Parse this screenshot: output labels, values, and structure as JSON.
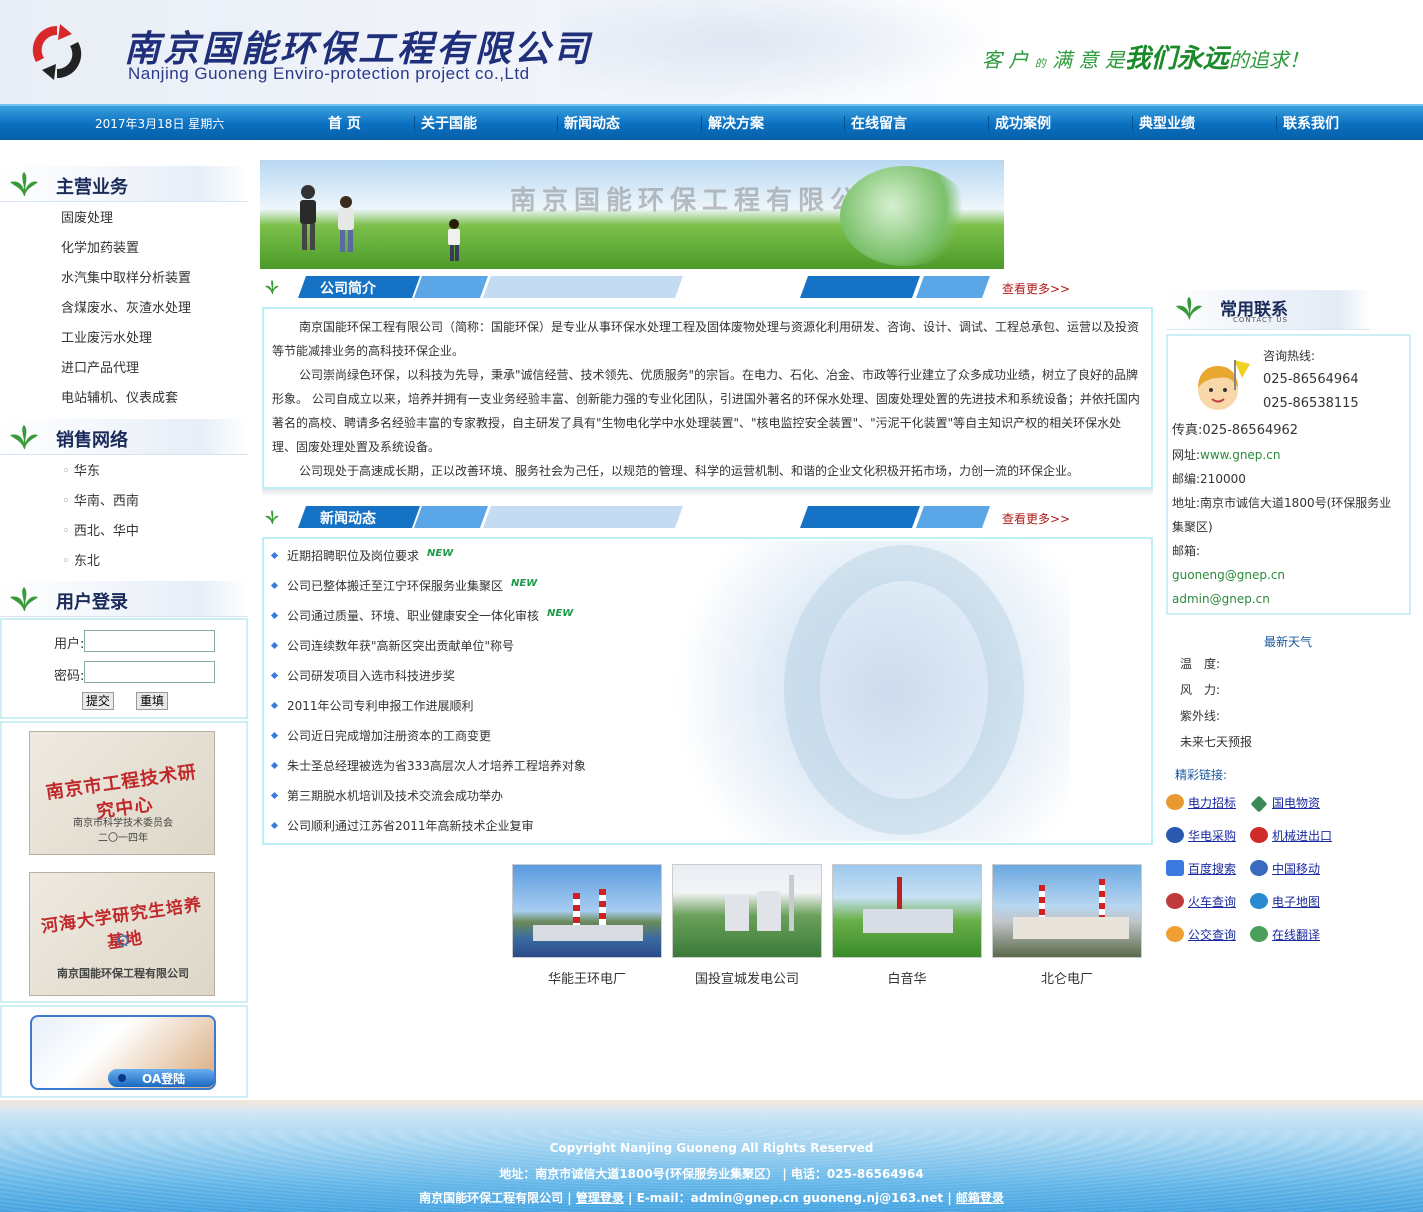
{
  "header": {
    "company_cn": "南京国能环保工程有限公司",
    "company_en": "Nanjing Guoneng Enviro-protection project co.,Ltd",
    "slogan_1": "客 户",
    "slogan_2": "的",
    "slogan_3": "满 意 是",
    "slogan_4": "我们永远",
    "slogan_5": "的追求！"
  },
  "nav": {
    "date": "2017年3月18日  星期六",
    "items": [
      "首 页",
      "关于国能",
      "新闻动态",
      "解决方案",
      "在线留言",
      "成功案例",
      "典型业绩",
      "联系我们"
    ]
  },
  "left": {
    "business_title": "主营业务",
    "business_items": [
      "固废处理",
      "化学加药装置",
      "水汽集中取样分析装置",
      "含煤废水、灰渣水处理",
      "工业废污水处理",
      "进口产品代理",
      "电站辅机、仪表成套"
    ],
    "sales_title": "销售网络",
    "sales_items": [
      "华东",
      "华南、西南",
      "西北、华中",
      "东北"
    ],
    "login_title": "用户登录",
    "login": {
      "user_label": "用户:",
      "pass_label": "密码:",
      "submit": "提交",
      "reset": "重填"
    },
    "cert1": {
      "title": "南京市工程技术研究中心",
      "line1": "南京市科学技术委员会",
      "line2": "二〇一四年"
    },
    "cert2": {
      "title": "河海大学研究生培养基地",
      "line1": "南京国能环保工程有限公司"
    },
    "oa_label": "OA登陆"
  },
  "banner": {
    "watermark": "南京国能环保工程有限公司"
  },
  "intro": {
    "title": "公司简介",
    "more": "查看更多>>",
    "paragraphs": [
      "南京国能环保工程有限公司（简称：国能环保）是专业从事环保水处理工程及固体废物处理与资源化利用研发、咨询、设计、调试、工程总承包、运营以及投资等节能减排业务的高科技环保企业。",
      "公司崇尚绿色环保，以科技为先导，秉承\"诚信经营、技术领先、优质服务\"的宗旨。在电力、石化、冶金、市政等行业建立了众多成功业绩，树立了良好的品牌形象。 公司自成立以来，培养并拥有一支业务经验丰富、创新能力强的专业化团队，引进国外著名的环保水处理、固废处理处置的先进技术和系统设备；并依托国内著名的高校、聘请多名经验丰富的专家教授，自主研发了具有\"生物电化学中水处理装置\"、\"核电监控安全装置\"、\"污泥干化装置\"等自主知识产权的相关环保水处理、固废处理处置及系统设备。",
      "公司现处于高速成长期，正以改善环境、服务社会为己任，以规范的管理、科学的运营机制、和谐的企业文化积极开拓市场，力创一流的环保企业。"
    ]
  },
  "news": {
    "title": "新闻动态",
    "more": "查看更多>>",
    "new_badge": "NEW",
    "items": [
      {
        "text": "近期招聘职位及岗位要求",
        "is_new": true
      },
      {
        "text": "公司已整体搬迁至江宁环保服务业集聚区",
        "is_new": true
      },
      {
        "text": "公司通过质量、环境、职业健康安全一体化审核",
        "is_new": true
      },
      {
        "text": "公司连续数年获\"高新区突出贡献单位\"称号",
        "is_new": false
      },
      {
        "text": "公司研发项目入选市科技进步奖",
        "is_new": false
      },
      {
        "text": "2011年公司专利申报工作进展顺利",
        "is_new": false
      },
      {
        "text": "公司近日完成增加注册资本的工商变更",
        "is_new": false
      },
      {
        "text": "朱士圣总经理被选为省333高层次人才培养工程培养对象",
        "is_new": false
      },
      {
        "text": "第三期脱水机培训及技术交流会成功举办",
        "is_new": false
      },
      {
        "text": "公司顺利通过江苏省2011年高新技术企业复审",
        "is_new": false
      }
    ]
  },
  "gallery": [
    "华能王环电厂",
    "国投宣城发电公司",
    "白音华",
    "北仑电厂"
  ],
  "contact": {
    "title": "常用联系",
    "subtitle": "CONTACT US",
    "hotline_label": "咨询热线:",
    "phone1": "025-86564964",
    "phone2": "025-86538115",
    "fax": "传真:025-86564962",
    "web_label": "网址:",
    "web": "www.gnep.cn",
    "zip": "邮编:210000",
    "addr1": "地址:南京市诚信大道1800号(环保服务业",
    "addr2": "集聚区)",
    "email_label": "邮箱:",
    "email1": "guoneng@gnep.cn",
    "email2": "admin@gnep.cn"
  },
  "weather": {
    "title": "最新天气",
    "temp": "温　度:",
    "wind": "风　力:",
    "uv": "紫外线:",
    "forecast": "未来七天预报"
  },
  "links": {
    "title": "精彩链接:",
    "items": [
      "电力招标",
      "国电物资",
      "华电采购",
      "机械进出口",
      "百度搜索",
      "中国移动",
      "火车查询",
      "电子地图",
      "公交查询",
      "在线翻译"
    ]
  },
  "footer": {
    "copyright": "Copyright Nanjing Guoneng All Rights Reserved",
    "address": "地址：南京市诚信大道1800号(环保服务业集聚区） | 电话：025-86564964",
    "company": "南京国能环保工程有限公司",
    "admin_login": "管理登录",
    "email": "E-mail：admin@gnep.cn    guoneng.nj@163.net",
    "mail_login": "邮箱登录"
  }
}
